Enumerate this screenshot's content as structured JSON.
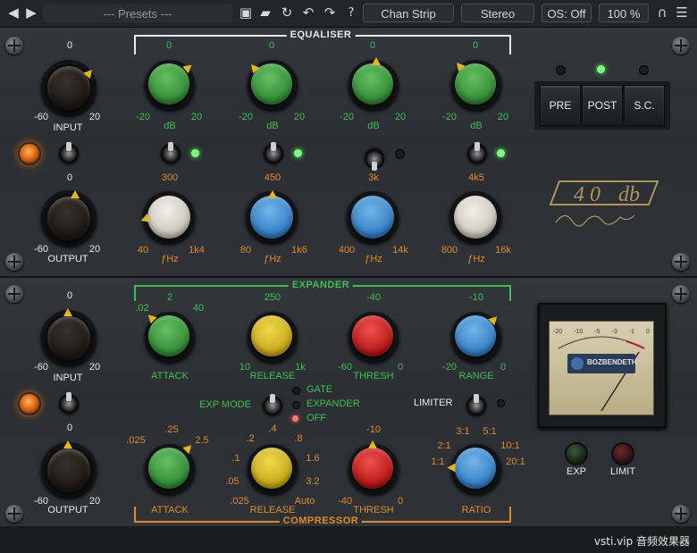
{
  "topbar": {
    "presets": "--- Presets ---",
    "chan_strip": "Chan Strip",
    "stereo": "Stereo",
    "os": "OS: Off",
    "zoom": "100 %",
    "help": "?"
  },
  "eq": {
    "title": "EQUALISER",
    "gain_top": "0",
    "gain_min": "-20",
    "gain_max": "20",
    "gain_unit": "dB",
    "freq_unit": "ƒHz",
    "bands": [
      {
        "top": "300",
        "min": "40",
        "max": "1k4"
      },
      {
        "top": "450",
        "min": "80",
        "max": "1k6"
      },
      {
        "top": "3k",
        "min": "400",
        "max": "14k"
      },
      {
        "top": "4k5",
        "min": "800",
        "max": "16k"
      }
    ],
    "input": {
      "top": "0",
      "min": "-60",
      "max": "20",
      "label": "INPUT"
    },
    "output": {
      "top": "0",
      "min": "-60",
      "max": "20",
      "label": "OUTPUT"
    },
    "pre": "PRE",
    "post": "POST",
    "sc": "S.C."
  },
  "dyn": {
    "expander_title": "EXPANDER",
    "compressor_title": "COMPRESSOR",
    "input": {
      "top": "0",
      "min": "-60",
      "max": "20",
      "label": "INPUT"
    },
    "output": {
      "top": "0",
      "min": "-60",
      "max": "20",
      "label": "OUTPUT"
    },
    "exp_attack": {
      "ticks": [
        ".02",
        "2",
        "40"
      ],
      "label": "ATTACK"
    },
    "exp_release": {
      "ticks": [
        "250",
        "10",
        "1k"
      ],
      "label": "RELEASE"
    },
    "exp_thresh": {
      "ticks": [
        "-40",
        "-60",
        "0"
      ],
      "label": "THRESH"
    },
    "exp_range": {
      "ticks": [
        "-10",
        "-20",
        "0"
      ],
      "label": "RANGE"
    },
    "exp_mode": {
      "label": "EXP MODE",
      "options": [
        "GATE",
        "EXPANDER",
        "OFF"
      ]
    },
    "limiter": "LIMITER",
    "cmp_attack": {
      "ticks": [
        ".025",
        ".25",
        "2.5"
      ],
      "label": "ATTACK"
    },
    "cmp_release": {
      "ticks": [
        ".2",
        ".4",
        ".8",
        ".1",
        "1.6",
        ".05",
        "3.2",
        ".025",
        "Auto"
      ],
      "label": "RELEASE"
    },
    "cmp_thresh": {
      "ticks": [
        "-10",
        "-40",
        "0"
      ],
      "label": "THRESH"
    },
    "cmp_ratio": {
      "ticks": [
        "3:1",
        "5:1",
        "2:1",
        "10:1",
        "1:1",
        "20:1"
      ],
      "label": "RATIO"
    },
    "meter_brand": "BOZBENDETH",
    "meter_scale": [
      "-20",
      "-10",
      "-5",
      "-3",
      "-1",
      "0"
    ],
    "exp": "EXP",
    "limit": "LIMIT"
  },
  "watermark": "vsti.vip 音频效果器",
  "colors": {
    "green": "#3fbf53",
    "orange": "#e08a2a",
    "yellow_knob": "#e2c32a",
    "red_knob": "#d82626",
    "blue_knob": "#3f8fd6",
    "green_knob": "#3a9a3e"
  }
}
